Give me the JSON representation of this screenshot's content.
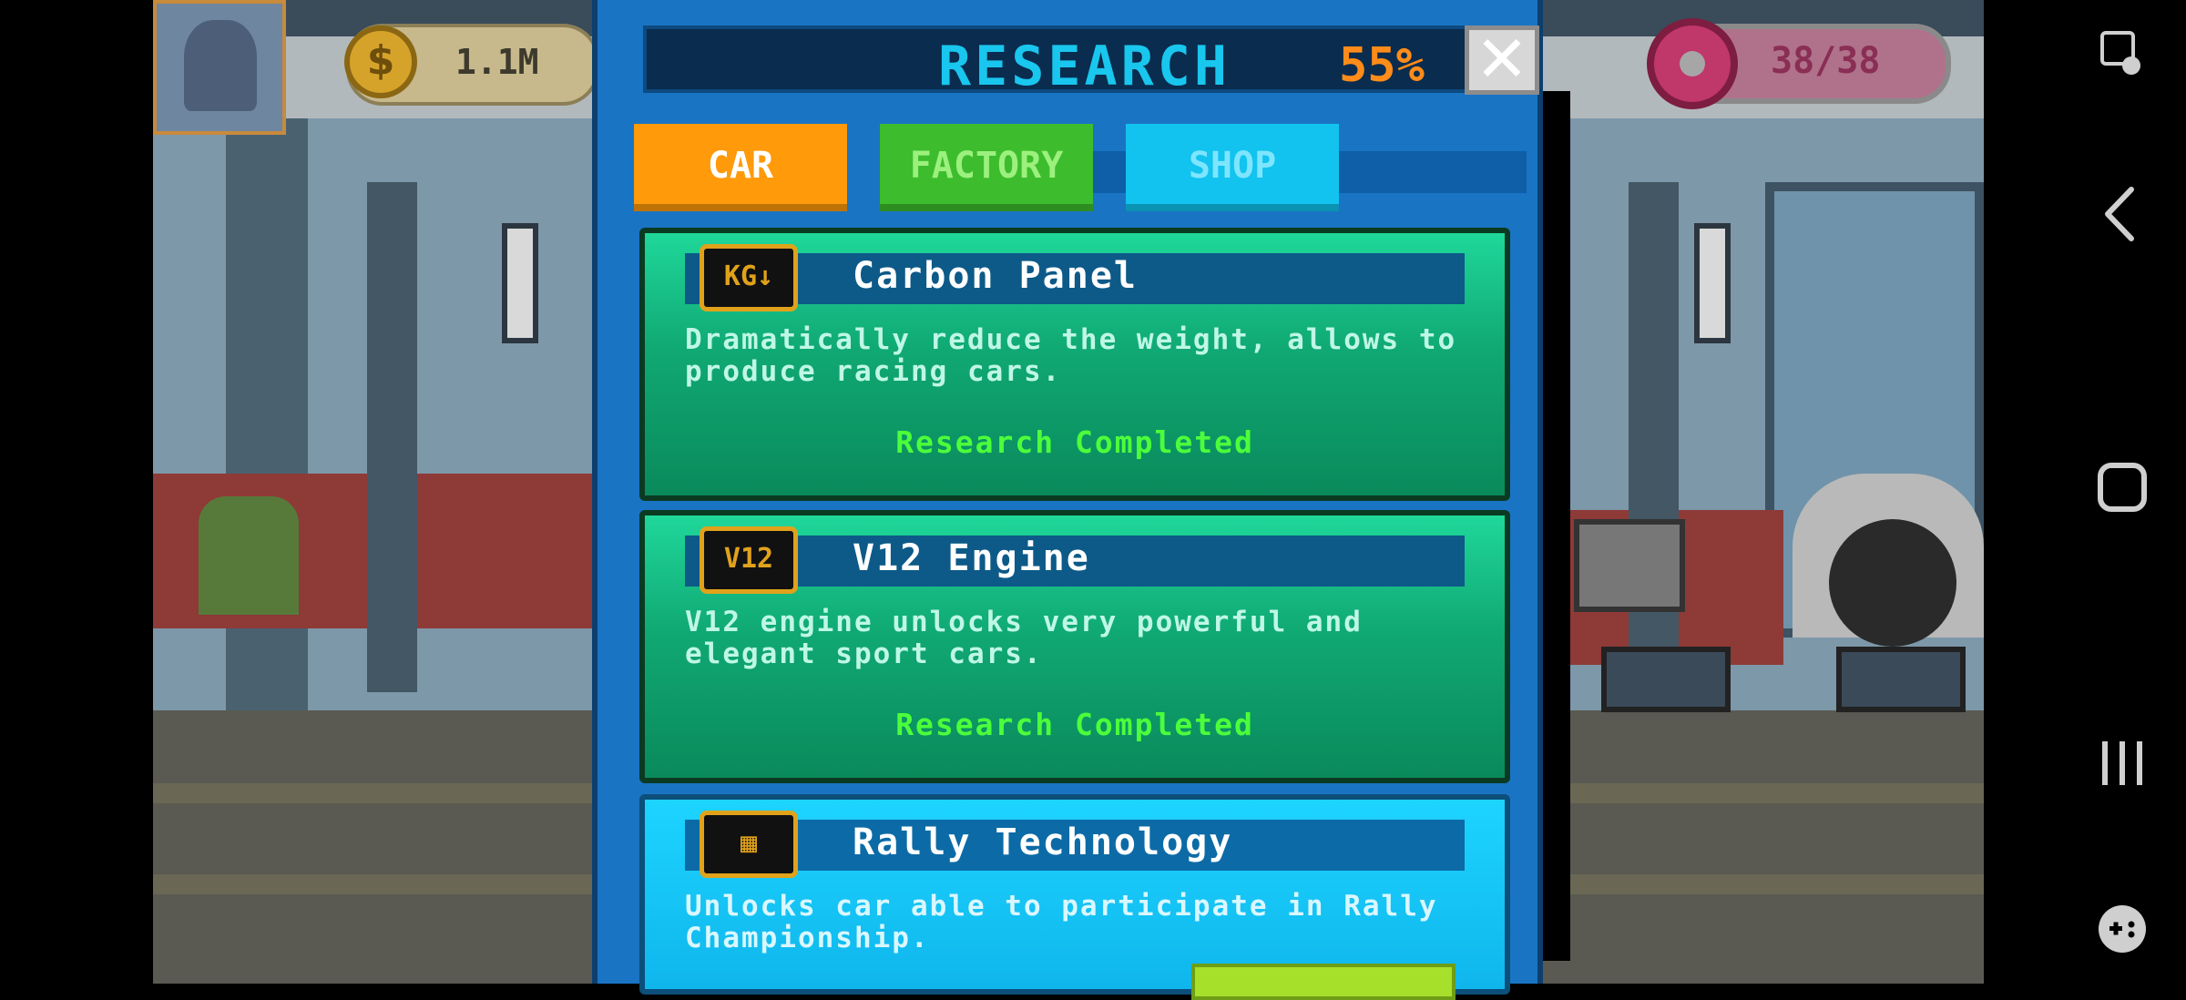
{
  "hud": {
    "coins": "1.1M",
    "coin_symbol": "$",
    "donuts": "38/38"
  },
  "research": {
    "title": "RESEARCH",
    "percent": "55%",
    "close_label": "✕",
    "tabs": [
      {
        "label": "CAR",
        "active": true
      },
      {
        "label": "FACTORY",
        "active": false
      },
      {
        "label": "SHOP",
        "active": false
      }
    ],
    "items": [
      {
        "icon": "weight-kg-icon",
        "icon_text": "KG↓",
        "title": "Carbon Panel",
        "description": "Dramatically reduce the weight, allows to produce racing cars.",
        "status": "Research Completed"
      },
      {
        "icon": "v12-engine-icon",
        "icon_text": "V12",
        "title": "V12 Engine",
        "description": "V12 engine unlocks very powerful and elegant sport cars.",
        "status": "Research Completed"
      },
      {
        "icon": "rally-flag-icon",
        "icon_text": "▦",
        "title": "Rally Technology",
        "description": "Unlocks car able to participate in Rally Championship.",
        "status": ""
      }
    ]
  },
  "colors": {
    "panel_bg": "#1a74c4",
    "title_text": "#19c6ee",
    "percent_text": "#ff8c1a",
    "tab_car": "#ff9a0a",
    "tab_factory": "#3dbd2d",
    "tab_shop": "#11c3ee",
    "completed_text": "#4cff3a"
  },
  "navbar": {
    "icons": [
      "screenshot-edit-icon",
      "back-icon",
      "home-icon",
      "recents-icon",
      "game-tools-icon"
    ]
  }
}
